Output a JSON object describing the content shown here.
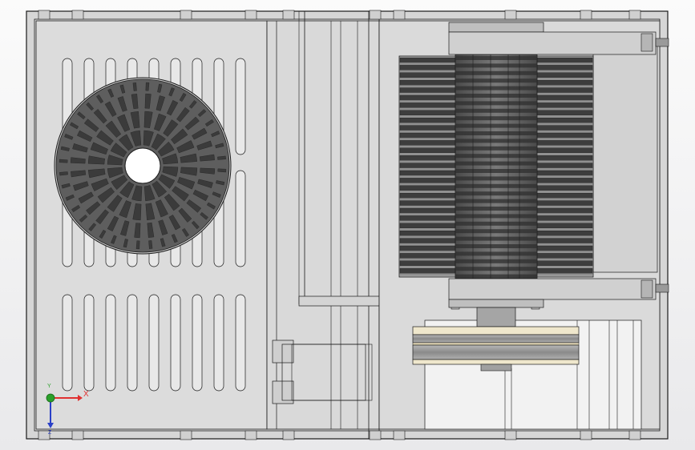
{
  "viewport": {
    "background_top": "#fbfbfb",
    "background_bottom": "#e9e9eb"
  },
  "model": {
    "panel_color": "#dcdcdc",
    "panel_dark": "#bdbdbd",
    "slot_color": "#e8e8e8",
    "edge_color": "#1a1a1a",
    "fan_grille_color": "#5e5e5e",
    "fan_slot_color": "#3b3b3b",
    "fins_color": "#3d3d3d",
    "fins_light": "#909090",
    "shaft_color": "#8a8a8a",
    "pulley_color": "#9a9a9a",
    "pulley_belt": "#6b6b6b",
    "pulley_rim": "#e4d9b8"
  },
  "triad": {
    "x_label": "X",
    "y_label": "Y",
    "z_label": "Z",
    "x_color": "#e03030",
    "y_color": "#2aa02a",
    "z_color": "#2a40c8"
  }
}
